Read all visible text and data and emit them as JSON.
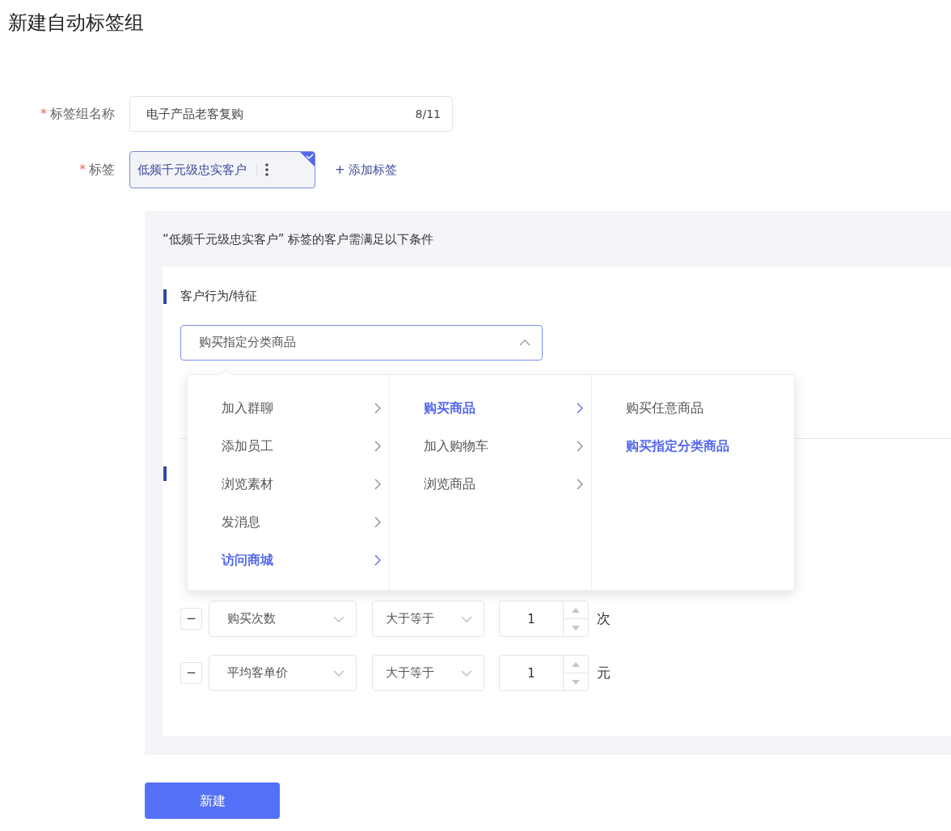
{
  "page_title": "新建自动标签组",
  "form": {
    "name_field": {
      "required_mark": "*",
      "label": "标签组名称",
      "value": "电子产品老客复购",
      "counter": "8/11"
    },
    "tags_field": {
      "required_mark": "*",
      "label": "标签",
      "tags": [
        {
          "text": "低频千元级忠实客户",
          "selected": true
        }
      ],
      "add_link": "+ 添加标签"
    }
  },
  "conditions": {
    "heading": "“低频千元级忠实客户” 标签的客户需满足以下条件",
    "section": {
      "title": "客户行为/特征",
      "select": {
        "value": "购买指定分类商品",
        "expanded": true
      }
    },
    "cascader": [
      {
        "items": [
          {
            "label": "加入群聊",
            "selected": false,
            "has_children": true
          },
          {
            "label": "添加员工",
            "selected": false,
            "has_children": true
          },
          {
            "label": "浏览素材",
            "selected": false,
            "has_children": true
          },
          {
            "label": "发消息",
            "selected": false,
            "has_children": true
          },
          {
            "label": "访问商城",
            "selected": true,
            "has_children": true
          }
        ]
      },
      {
        "items": [
          {
            "label": "购买商品",
            "selected": true,
            "has_children": true
          },
          {
            "label": "加入购物车",
            "selected": false,
            "has_children": true
          },
          {
            "label": "浏览商品",
            "selected": false,
            "has_children": true
          }
        ]
      },
      {
        "items": [
          {
            "label": "购买任意商品",
            "selected": false,
            "has_children": false
          },
          {
            "label": "购买指定分类商品",
            "selected": true,
            "has_children": false
          }
        ]
      }
    ],
    "rows": [
      {
        "remove": "−",
        "metric": "购买次数",
        "operator": "大于等于",
        "value": "1",
        "unit": "次"
      },
      {
        "remove": "−",
        "metric": "平均客单价",
        "operator": "大于等于",
        "value": "1",
        "unit": "元"
      }
    ]
  },
  "submit": "新建"
}
